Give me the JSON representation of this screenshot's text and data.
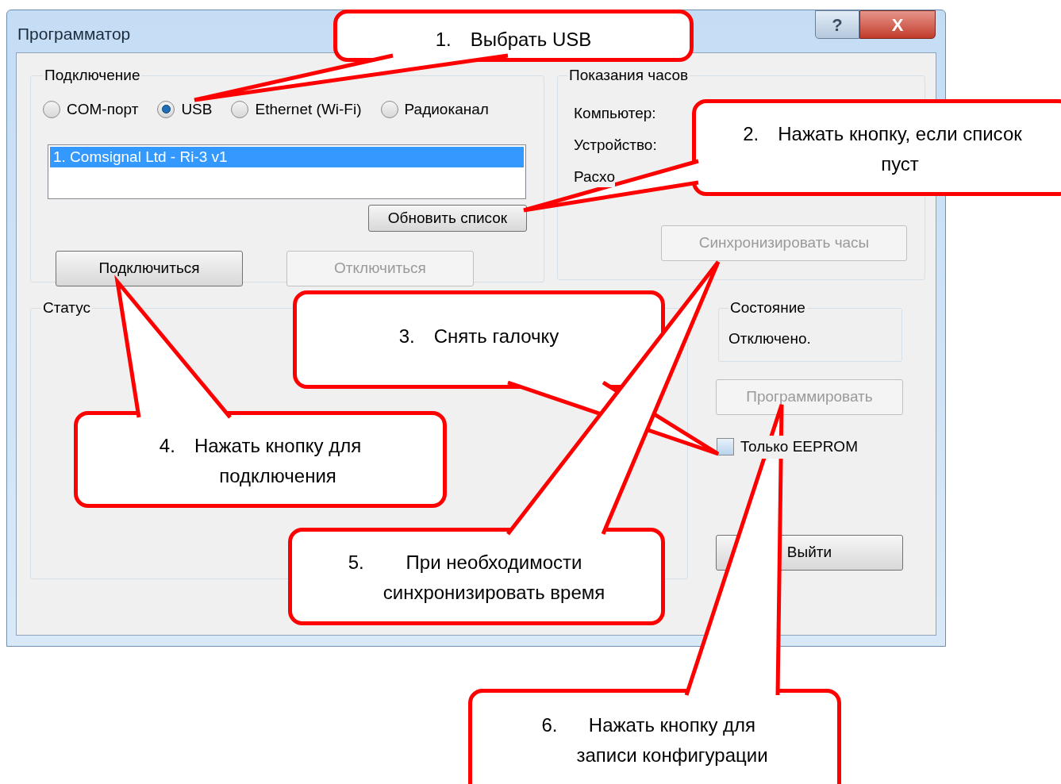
{
  "window": {
    "title": "Программатор",
    "help_button": "?",
    "close_button": "X"
  },
  "connection": {
    "title": "Подключение",
    "options": [
      {
        "label": "COM-порт",
        "selected": false
      },
      {
        "label": "USB",
        "selected": true
      },
      {
        "label": "Ethernet (Wi-Fi)",
        "selected": false
      },
      {
        "label": "Радиоканал",
        "selected": false
      }
    ],
    "devices": [
      {
        "label": "1. Comsignal Ltd - Ri-3 v1",
        "selected": true
      }
    ],
    "refresh_button": {
      "label": "Обновить список",
      "disabled": false
    },
    "connect_button": {
      "label": "Подключиться",
      "disabled": false
    },
    "disconnect_button": {
      "label": "Отключиться",
      "disabled": true
    }
  },
  "clock": {
    "title": "Показания часов",
    "labels": [
      "Компьютер:",
      "Устройство:",
      "Расхо"
    ],
    "sync_button": {
      "label": "Синхронизировать часы",
      "disabled": true
    }
  },
  "status": {
    "title": "Статус"
  },
  "state": {
    "title": "Состояние",
    "value": "Отключено."
  },
  "program_button": {
    "label": "Программировать",
    "disabled": true
  },
  "eeprom_only": {
    "label": "Только EEPROM",
    "checked": false
  },
  "exit_button": {
    "label": "Выйти",
    "disabled": false
  },
  "callouts": [
    {
      "number": "1.",
      "lines": [
        "Выбрать USB"
      ]
    },
    {
      "number": "2.",
      "lines": [
        "Нажать кнопку, если список",
        "пуст"
      ]
    },
    {
      "number": "3.",
      "lines": [
        "Снять  галочку"
      ]
    },
    {
      "number": "4.",
      "lines": [
        "Нажать кнопку для",
        "подключения"
      ]
    },
    {
      "number": "5.",
      "lines": [
        "При необходимости",
        "синхронизировать время"
      ]
    },
    {
      "number": "6.",
      "lines": [
        "Нажать кнопку для",
        "записи конфигурации"
      ]
    }
  ]
}
